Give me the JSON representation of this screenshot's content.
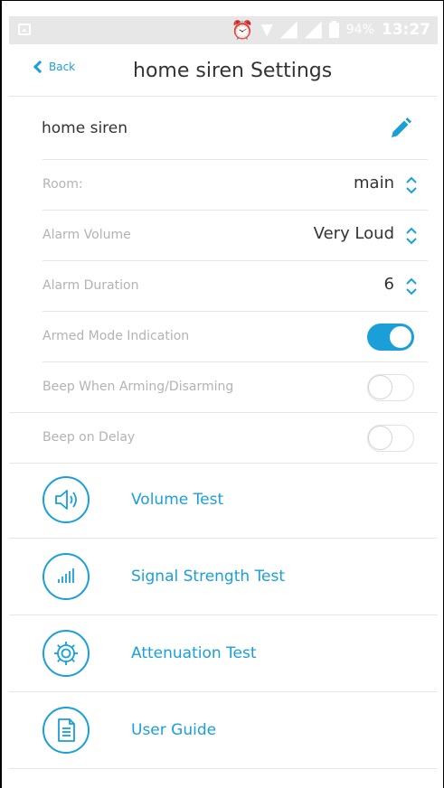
{
  "status_bar": {
    "battery_percent": "94%",
    "time": "13:27",
    "icons": [
      "gallery-icon",
      "alarm-clock-icon",
      "wifi-icon",
      "signal-icon",
      "signal-icon",
      "battery-icon"
    ]
  },
  "header": {
    "back_label": "Back",
    "title": "home siren Settings"
  },
  "device": {
    "name": "home siren",
    "edit_icon": "pencil-icon"
  },
  "settings": {
    "room": {
      "label": "Room:",
      "value": "main"
    },
    "alarm_volume": {
      "label": "Alarm Volume",
      "value": "Very Loud"
    },
    "alarm_duration": {
      "label": "Alarm Duration",
      "value": "6"
    },
    "armed_mode": {
      "label": "Armed Mode Indication",
      "enabled": true
    },
    "beep_arming": {
      "label": "Beep When Arming/Disarming",
      "enabled": false
    },
    "beep_delay": {
      "label": "Beep on Delay",
      "enabled": false
    }
  },
  "tests": [
    {
      "label": "Volume Test",
      "icon": "speaker-icon"
    },
    {
      "label": "Signal Strength Test",
      "icon": "signal-bars-icon"
    },
    {
      "label": "Attenuation Test",
      "icon": "gear-icon"
    },
    {
      "label": "User Guide",
      "icon": "document-icon"
    }
  ],
  "colors": {
    "accent": "#1a9fd9",
    "status_bar_bg": "#e7e7e7",
    "muted_text": "#b3b3b3",
    "text": "#333333"
  }
}
